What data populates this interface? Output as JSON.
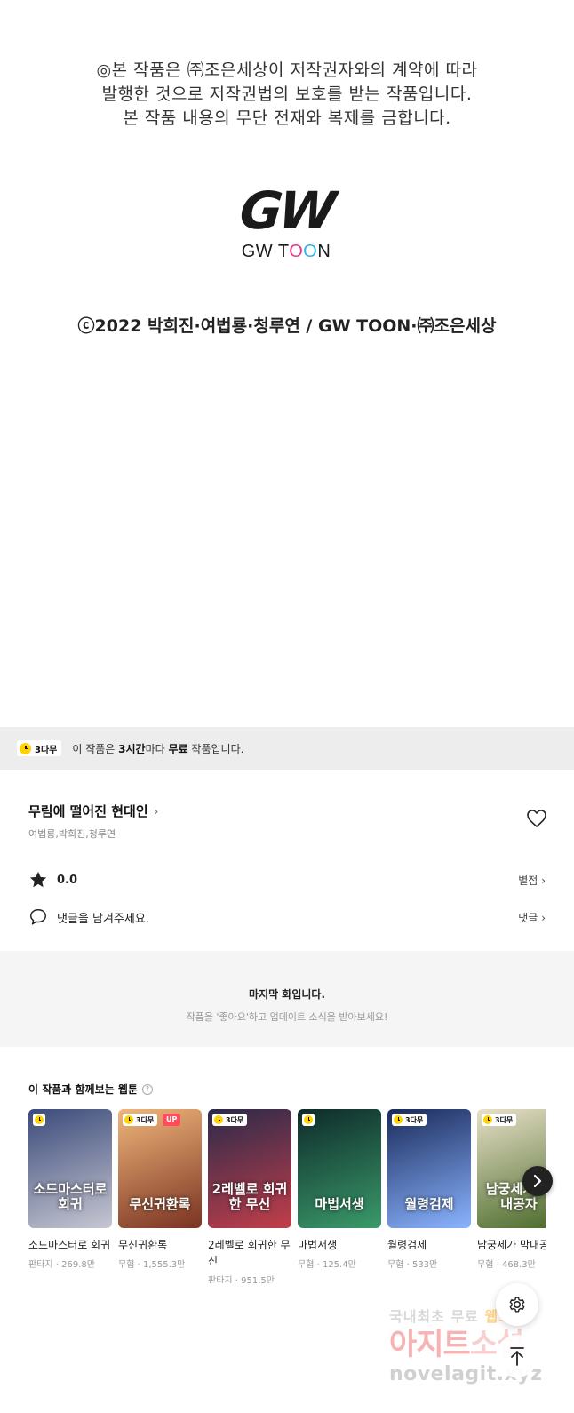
{
  "copyright_image": {
    "notice_lines": [
      "◎본 작품은 ㈜조은세상이 저작권자와의 계약에 따라",
      "발행한 것으로 저작권법의 보호를 받는 작품입니다.",
      "본 작품 내용의 무단 전재와 복제를 금합니다."
    ],
    "logo_mark": "GW",
    "logo_text_prefix": "GW T",
    "logo_text_o1": "O",
    "logo_text_o2": "O",
    "logo_text_suffix": "N",
    "credits": "ⓒ2022 박희진·여법룡·청루연 / GW TOON·㈜조은세상"
  },
  "free_banner": {
    "badge": "3다무",
    "text_prefix": "이 작품은 ",
    "text_bold_time": "3시간",
    "text_mid": "마다 ",
    "text_bold_free": "무료",
    "text_suffix": " 작품입니다."
  },
  "work": {
    "title": "무림에 떨어진 현대인",
    "title_chevron": "›",
    "authors": "여법룡,박희진,청루연",
    "rating_value": "0.0",
    "rating_link": "별점",
    "comment_prompt": "댓글을 남겨주세요.",
    "comment_link": "댓글",
    "chevron": "›"
  },
  "last_episode": {
    "title": "마지막 화입니다.",
    "subtitle": "작품을 '좋아요'하고 업데이트 소식을 받아보세요!"
  },
  "recommendations": {
    "heading": "이 작품과 함께보는 웹툰",
    "help": "?",
    "items": [
      {
        "badge": "",
        "up": "",
        "cover_text": "소드마스터로 회귀",
        "title": "소드마스터로 회귀",
        "genre": "판타지",
        "views": "269.8만",
        "color_top": "#3a4a7a",
        "color_bottom": "#c7c7d2"
      },
      {
        "badge": "3다무",
        "up": "UP",
        "cover_text": "무신귀환록",
        "title": "무신귀환록",
        "genre": "무협",
        "views": "1,555.3만",
        "color_top": "#f0b67a",
        "color_bottom": "#7a3322"
      },
      {
        "badge": "3다무",
        "up": "",
        "cover_text": "2레벨로 회귀한 무신",
        "title": "2레벨로 회귀한 무신",
        "genre": "판타지",
        "views": "951.5만",
        "color_top": "#2a2a4a",
        "color_bottom": "#c23e4a"
      },
      {
        "badge": "",
        "up": "",
        "cover_text": "마법서생",
        "title": "마법서생",
        "genre": "무협",
        "views": "125.4만",
        "color_top": "#0e2a2a",
        "color_bottom": "#3a9a6a"
      },
      {
        "badge": "3다무",
        "up": "",
        "cover_text": "월령검제",
        "title": "월령검제",
        "genre": "무협",
        "views": "533만",
        "color_top": "#1a2a5a",
        "color_bottom": "#8ab4ff"
      },
      {
        "badge": "3다무",
        "up": "",
        "cover_text": "남궁세가 막내공자",
        "title": "남궁세가 막내공자",
        "genre": "무협",
        "views": "468.3만",
        "color_top": "#e8e0c8",
        "color_bottom": "#4a6a2a"
      }
    ],
    "meta_separator": " · "
  },
  "watermark": {
    "line1_a": "국내최초 무료 ",
    "line1_b": "웹소설",
    "line2_a": "아지트",
    "line2_b": "소설",
    "line3": "novelagit.xyz"
  },
  "icons": {
    "heart": "heart-icon",
    "star": "star-icon",
    "comment": "comment-bubble-icon",
    "next": "chevron-right-icon",
    "settings": "gear-icon",
    "top": "arrow-up-icon"
  }
}
